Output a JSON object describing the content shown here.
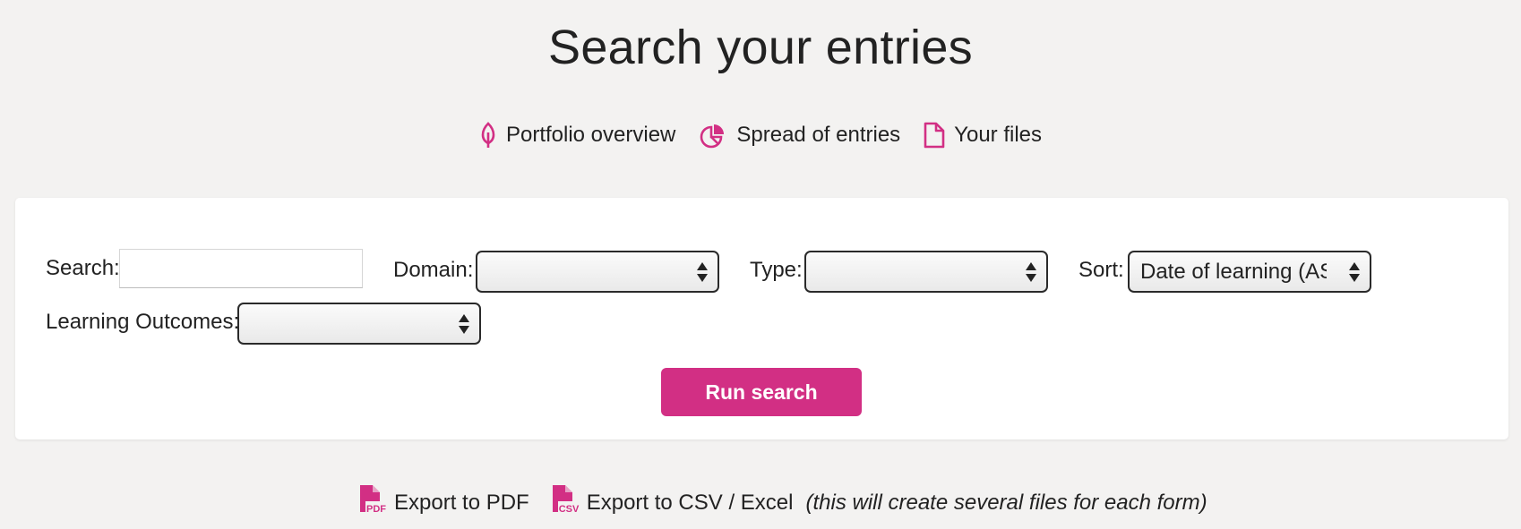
{
  "page": {
    "title": "Search your entries"
  },
  "nav": {
    "items": [
      {
        "label": "Portfolio overview",
        "icon": "leaf-icon"
      },
      {
        "label": "Spread of entries",
        "icon": "pie-chart-icon"
      },
      {
        "label": "Your files",
        "icon": "file-icon"
      }
    ]
  },
  "form": {
    "search_label": "Search:",
    "search_value": "",
    "search_placeholder": "",
    "domain_label": "Domain:",
    "domain_value": "",
    "type_label": "Type:",
    "type_value": "",
    "sort_label": "Sort:",
    "sort_value": "Date of learning (ASC",
    "outcomes_label": "Learning Outcomes:",
    "outcomes_value": "",
    "run_label": "Run search"
  },
  "export": {
    "pdf_label": "Export to PDF",
    "csv_label": "Export to CSV / Excel",
    "csv_note": "(this will create several files for each form)",
    "pdf_badge": "PDF",
    "csv_badge": "CSV"
  },
  "colors": {
    "accent": "#d22f84",
    "background": "#f3f2f1",
    "card": "#ffffff"
  }
}
